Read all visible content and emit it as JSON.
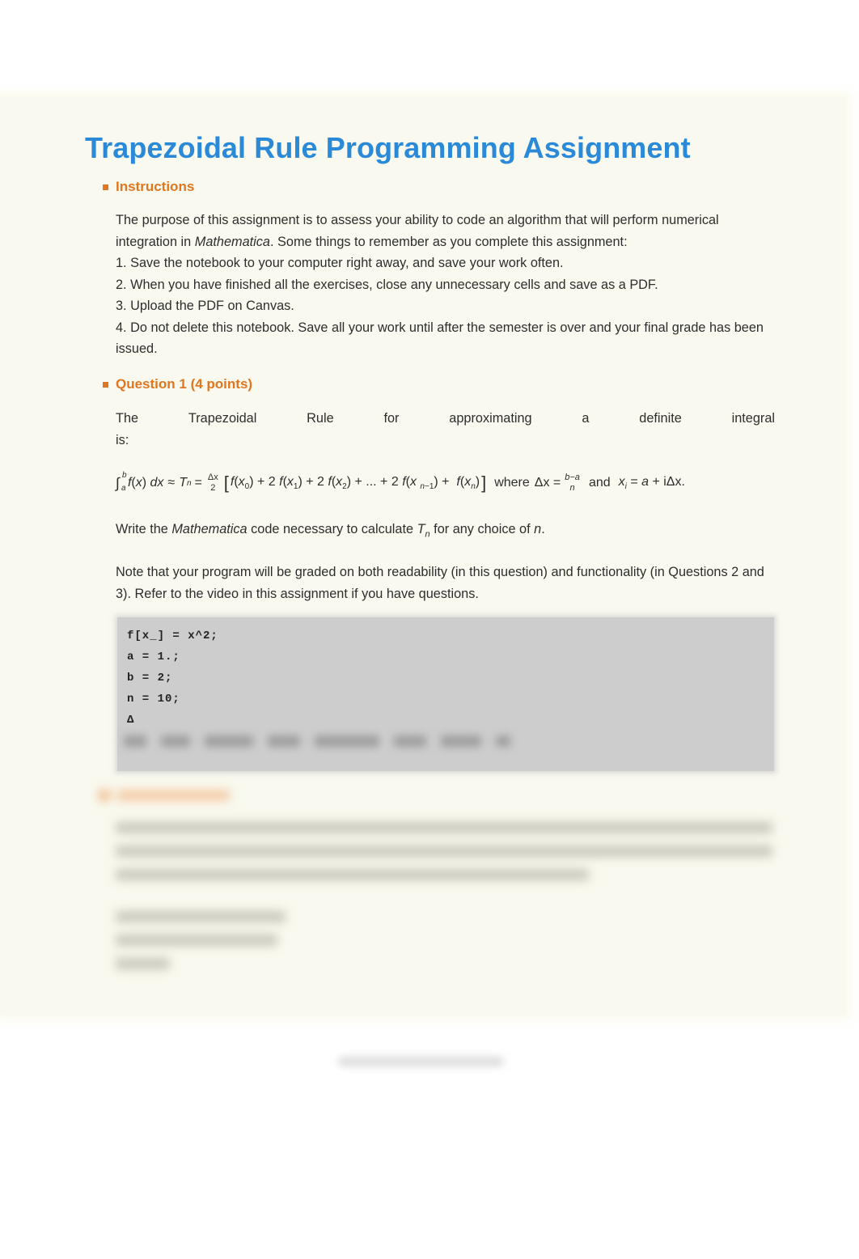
{
  "document": {
    "title": "Trapezoidal Rule Programming Assignment",
    "colors": {
      "title": "#2a8ad8",
      "section_heading": "#e0761f",
      "page_background": "#f9f9ef",
      "code_cell_background": "#cdcdcd"
    }
  },
  "instructions": {
    "heading": "Instructions",
    "intro_part1": "The purpose of this assignment is to assess your ability to code an algorithm that will perform numerical integration in ",
    "intro_software": "Mathematica",
    "intro_part2": ". Some things to remember as you complete this assignment:",
    "items": [
      "1.  Save the notebook to your computer right away, and save your work often.",
      "2. When you have finished all the exercises, close any unnecessary cells and save as a PDF.",
      "3. Upload the PDF on Canvas.",
      "4. Do not delete this notebook. Save all your work until after the semester is over and your final grade has been issued."
    ]
  },
  "question1": {
    "heading": "Question 1 (4 points)",
    "intro_words": [
      "The",
      "Trapezoidal",
      "Rule",
      "for",
      "approximating",
      "a",
      "definite",
      "integral"
    ],
    "intro_tail": "is:",
    "formula": {
      "lower_limit": "a",
      "upper_limit": "b",
      "integrand": "f(x) dx",
      "approx": "≈",
      "T": "T",
      "T_sub": "n",
      "equals": "=",
      "coef_num": "Δx",
      "coef_den": "2",
      "terms": "f(x0) + 2 f(x1) + 2 f(x2) + ... + 2 f(xn−1) + f(xn)",
      "where": "where",
      "dx_label": "Δx =",
      "dx_num": "b−a",
      "dx_den": "n",
      "and": "and",
      "xi_def": "xi = a + iΔx."
    },
    "write_part1": "Write the ",
    "write_software": "Mathematica",
    "write_part2": " code necessary to calculate ",
    "write_T": "T",
    "write_T_sub": "n",
    "write_part3": " for any choice of ",
    "write_n": "n",
    "write_part4": ".",
    "note": "Note that your program will be graded on both readability (in this question) and functionality (in Questions 2 and 3). Refer to the video in this assignment if you have questions.",
    "code_lines": [
      "f[x_] = x^2;",
      "a = 1.;",
      "b = 2;",
      "n = 10;",
      "Δ"
    ]
  }
}
